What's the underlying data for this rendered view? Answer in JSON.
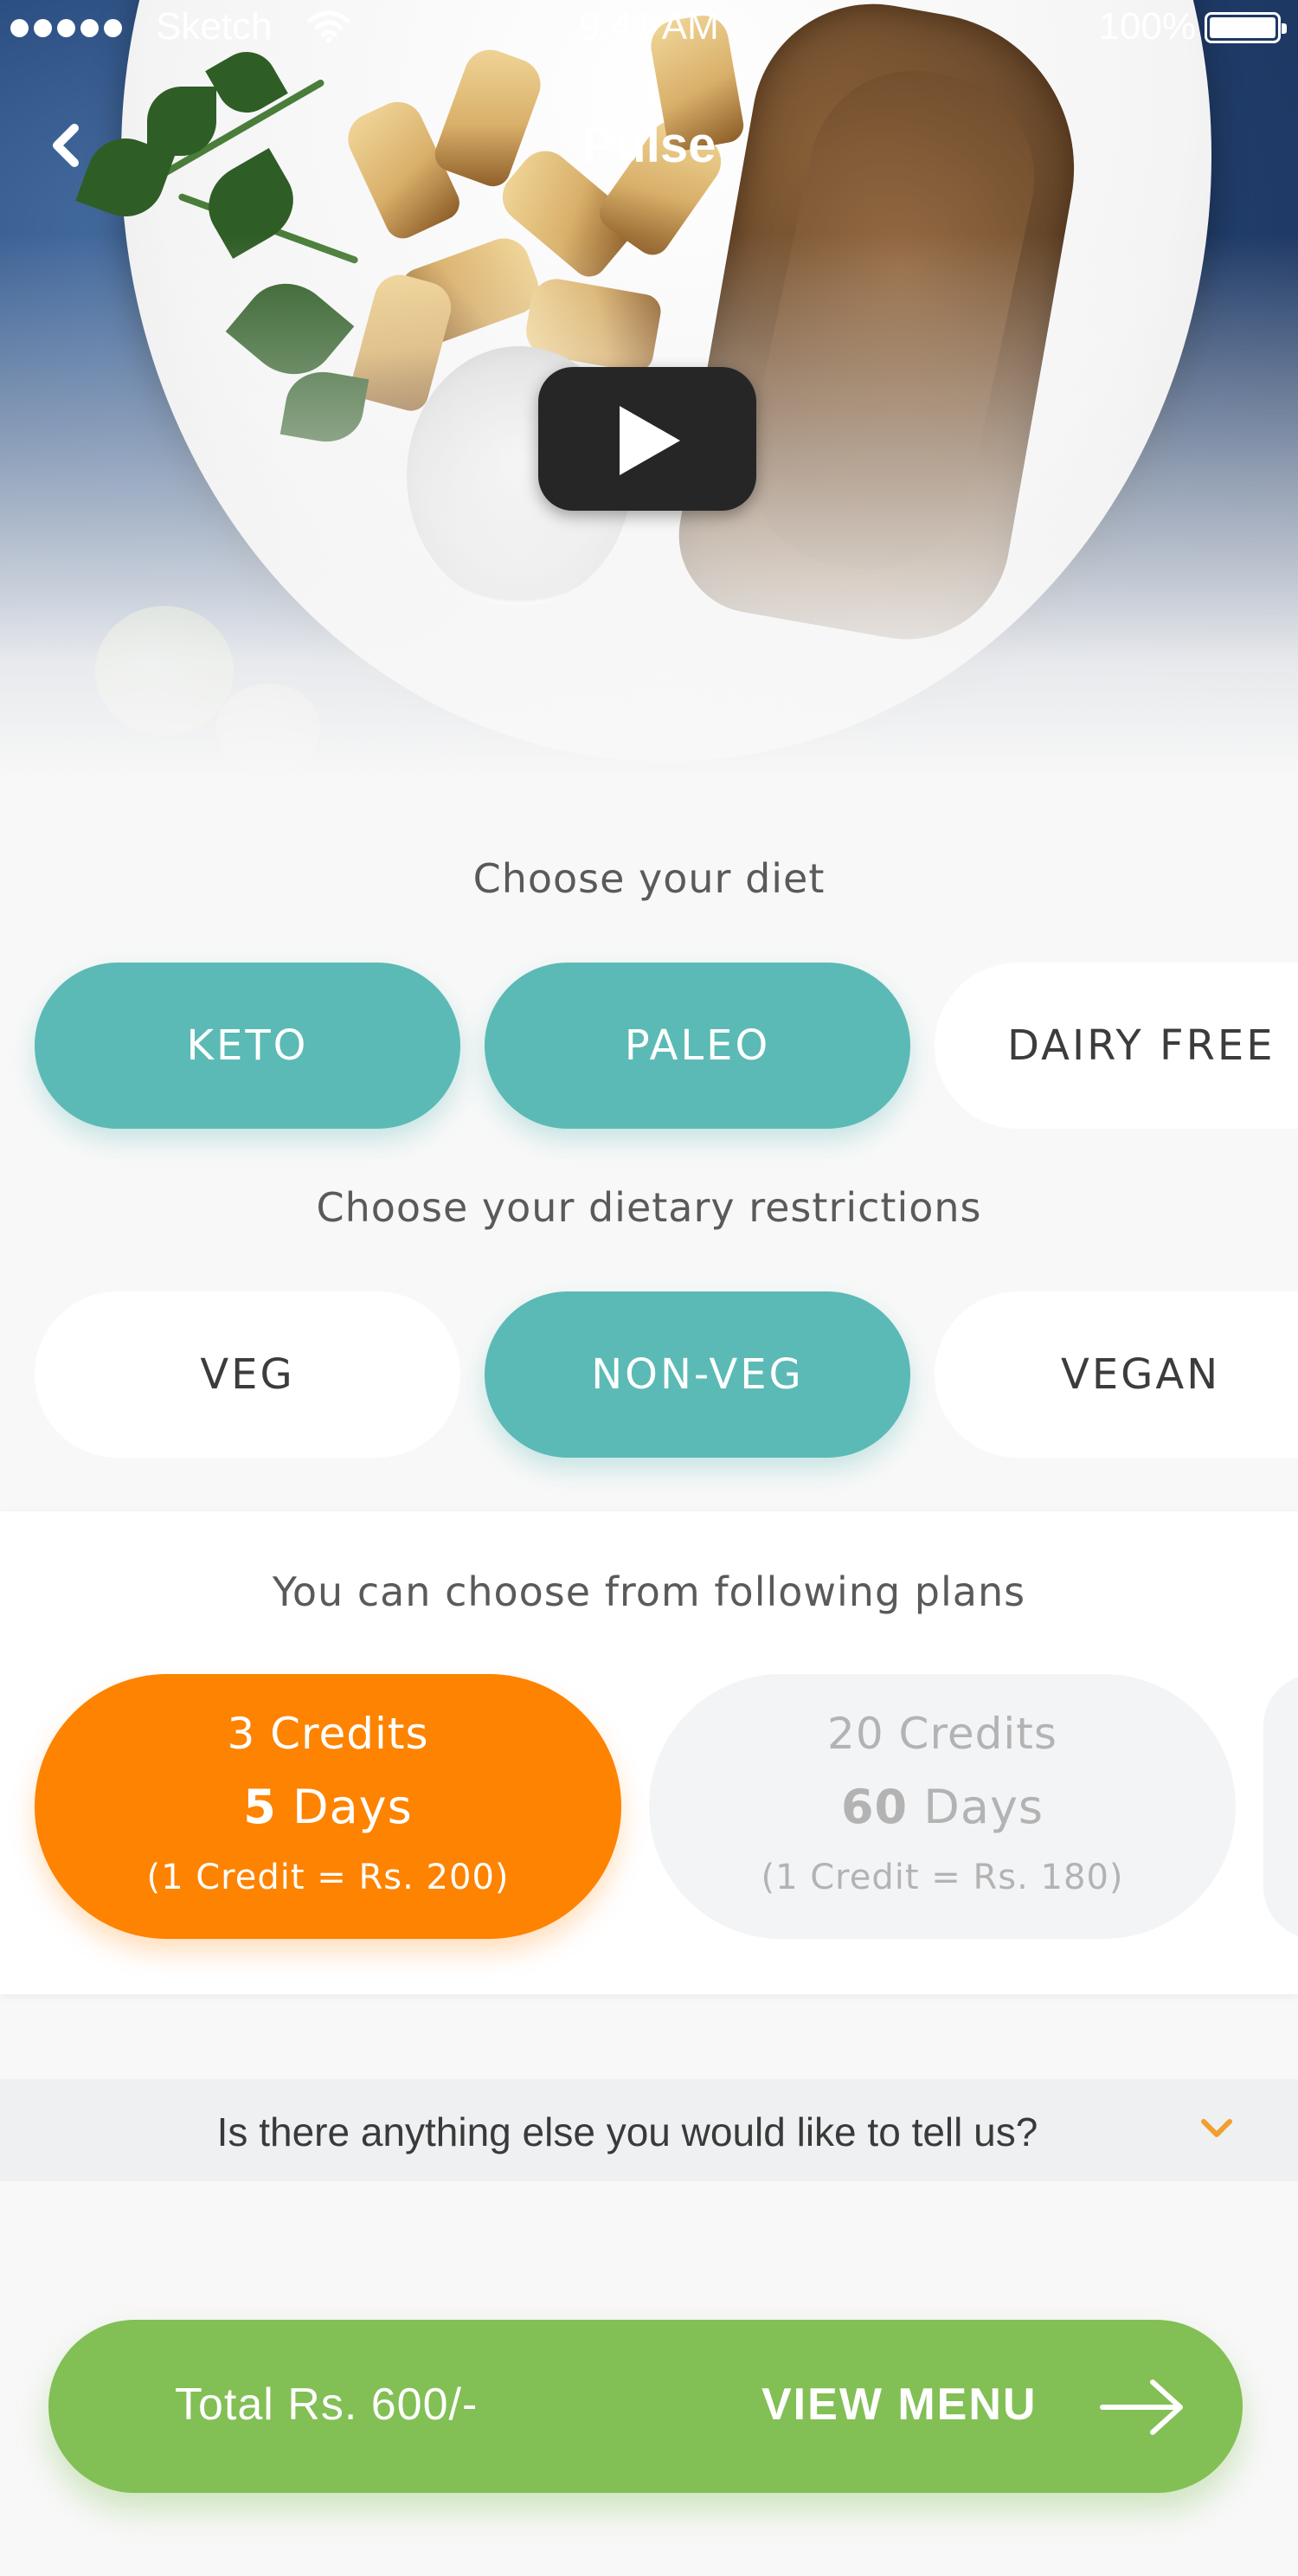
{
  "status_bar": {
    "carrier": "Sketch",
    "time": "9:41 AM",
    "battery_percent": "100%",
    "battery_level": 1.0,
    "signal_icon": "signal-dots-icon",
    "wifi_icon": "wifi-icon",
    "battery_icon": "battery-icon"
  },
  "header": {
    "title": "Pulse",
    "back_icon": "chevron-left-icon"
  },
  "hero": {
    "play_icon": "play-icon"
  },
  "diet": {
    "label": "Choose your diet",
    "options": [
      {
        "label": "KETO",
        "selected": true
      },
      {
        "label": "PALEO",
        "selected": true
      },
      {
        "label": "DAIRY FREE",
        "selected": false
      }
    ]
  },
  "restrictions": {
    "label": "Choose your dietary restrictions",
    "options": [
      {
        "label": "VEG",
        "selected": false
      },
      {
        "label": "NON-VEG",
        "selected": true
      },
      {
        "label": "VEGAN",
        "selected": false
      }
    ]
  },
  "plans": {
    "label": "You can choose from following plans",
    "items": [
      {
        "credits": "3 Credits",
        "days_num": "5",
        "days_unit": "Days",
        "rate": "(1 Credit = Rs. 200)",
        "selected": true
      },
      {
        "credits": "20 Credits",
        "days_num": "60",
        "days_unit": "Days",
        "rate": "(1 Credit = Rs. 180)",
        "selected": false
      }
    ]
  },
  "notes": {
    "question": "Is there anything else you would like to tell us?",
    "icon": "chevron-down-icon"
  },
  "cta": {
    "total": "Total Rs. 600/-",
    "action": "VIEW MENU",
    "icon": "arrow-right-icon"
  },
  "colors": {
    "teal": "#5bbab5",
    "orange": "#fe8300",
    "green": "#82bf55",
    "background": "#f8f8f8"
  }
}
